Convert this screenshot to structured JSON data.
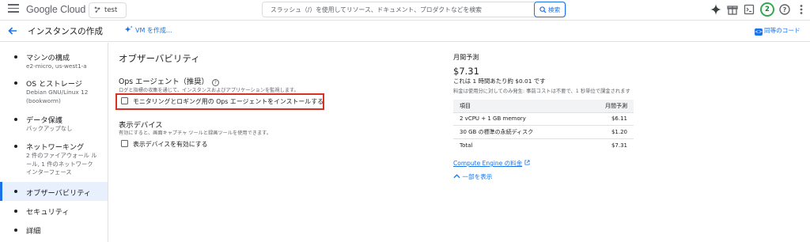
{
  "topbar": {
    "logo": "Google Cloud",
    "project": "test",
    "search_placeholder": "スラッシュ（/）を使用してリソース、ドキュメント、プロダクトなどを検索",
    "search_button": "検索",
    "avatar": "2"
  },
  "titlebar": {
    "title": "インスタンスの作成",
    "vm_create": "VM を作成...",
    "equivalent_code": "同等のコード"
  },
  "sidebar": {
    "items": [
      {
        "label": "マシンの構成",
        "sub": "e2-micro, us-west1-a"
      },
      {
        "label": "OS とストレージ",
        "sub": "Debian GNU/Linux 12 (bookworm)"
      },
      {
        "label": "データ保護",
        "sub": "バックアップなし"
      },
      {
        "label": "ネットワーキング",
        "sub": "2 件のファイアウォール ルール, 1 件のネットワーク インターフェース"
      },
      {
        "label": "オブザーバビリティ",
        "sub": ""
      },
      {
        "label": "セキュリティ",
        "sub": ""
      },
      {
        "label": "詳細",
        "sub": ""
      }
    ]
  },
  "main": {
    "heading": "オブザーバビリティ",
    "ops_title": "Ops エージェント（推奨）",
    "ops_desc": "ログと指標の収集を通じて、インスタンスおよびアプリケーションを監視します。",
    "ops_checkbox": "モニタリングとロギング用の Ops エージェントをインストールする",
    "display_title": "表示デバイス",
    "display_desc": "有効にすると、画面キャプチャ ツールと録画ツールを使用できます。",
    "display_checkbox": "表示デバイスを有効にする"
  },
  "estimate": {
    "title": "月間予測",
    "price": "$7.31",
    "hourly": "これは 1 時間あたり約 $0.01 です",
    "note": "料金は使用分に対してのみ発生: 事前コストは不要で、1 秒単位で課金されます",
    "col_item": "項目",
    "col_monthly": "月間予測",
    "rows": [
      {
        "item": "2 vCPU + 1 GB memory",
        "cost": "$6.11"
      },
      {
        "item": "30 GB の標準の永続ディスク",
        "cost": "$1.20"
      },
      {
        "item": "Total",
        "cost": "$7.31"
      }
    ],
    "pricing_link": "Compute Engine の料金",
    "show_less": "一部を表示"
  }
}
